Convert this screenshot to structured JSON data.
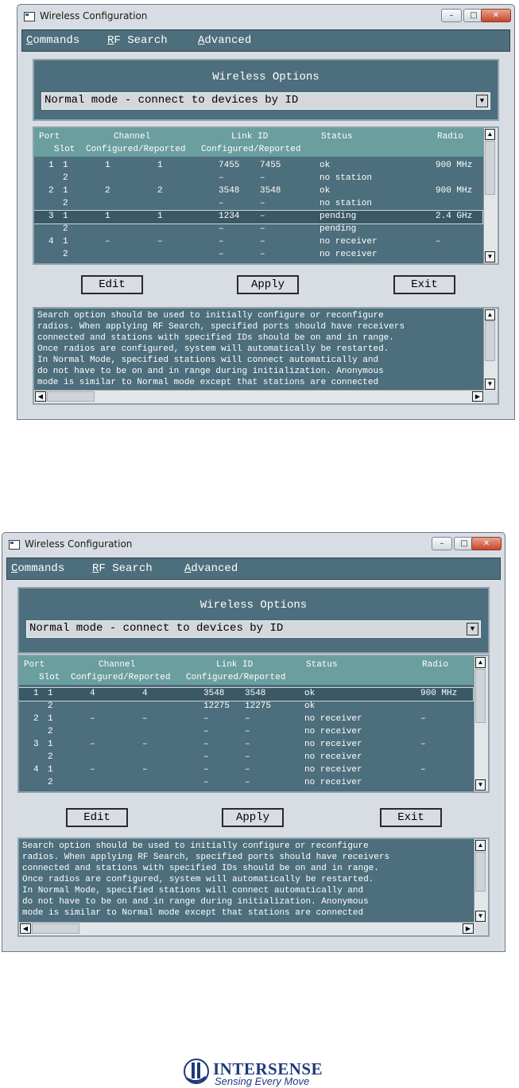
{
  "windows": [
    {
      "title": "Wireless Configuration",
      "controls": {
        "minimize": "–",
        "maximize": "□",
        "close": "✕"
      },
      "menu": [
        {
          "label_rest": "ommands",
          "accel": "C"
        },
        {
          "label_rest": "F Search",
          "accel": "R"
        },
        {
          "label_rest": "dvanced",
          "accel": "A"
        }
      ],
      "options_title": "Wireless Options",
      "mode": "Normal mode - connect to devices by ID",
      "headers": {
        "port": "Port",
        "slot": "Slot",
        "channel": "Channel",
        "channel_sub": "Configured/Reported",
        "link_id": "Link ID",
        "link_id_sub": "Configured/Reported",
        "status": "Status",
        "radio": "Radio"
      },
      "rows": [
        {
          "port": "1",
          "slot": "1",
          "ch_conf": "1",
          "ch_rep": "1",
          "id_conf": "7455",
          "id_rep": "7455",
          "status": "ok",
          "radio": "900 MHz"
        },
        {
          "port": "",
          "slot": "2",
          "ch_conf": "",
          "ch_rep": "",
          "id_conf": "–",
          "id_rep": "–",
          "status": "no station",
          "radio": ""
        },
        {
          "port": "2",
          "slot": "1",
          "ch_conf": "2",
          "ch_rep": "2",
          "id_conf": "3548",
          "id_rep": "3548",
          "status": "ok",
          "radio": "900 MHz"
        },
        {
          "port": "",
          "slot": "2",
          "ch_conf": "",
          "ch_rep": "",
          "id_conf": "–",
          "id_rep": "–",
          "status": "no station",
          "radio": ""
        },
        {
          "port": "3",
          "slot": "1",
          "ch_conf": "1",
          "ch_rep": "1",
          "id_conf": "1234",
          "id_rep": "–",
          "status": "pending",
          "radio": "2.4 GHz"
        },
        {
          "port": "",
          "slot": "2",
          "ch_conf": "",
          "ch_rep": "",
          "id_conf": "–",
          "id_rep": "–",
          "status": "pending",
          "radio": ""
        },
        {
          "port": "4",
          "slot": "1",
          "ch_conf": "–",
          "ch_rep": "–",
          "id_conf": "–",
          "id_rep": "–",
          "status": "no receiver",
          "radio": "–"
        },
        {
          "port": "",
          "slot": "2",
          "ch_conf": "",
          "ch_rep": "",
          "id_conf": "–",
          "id_rep": "–",
          "status": "no receiver",
          "radio": ""
        }
      ],
      "selected_row": 4,
      "buttons": {
        "edit": "Edit",
        "apply": "Apply",
        "exit": "Exit"
      },
      "help_lines": [
        "Search option should be used to initially configure or reconfigure",
        "radios. When applying RF Search, specified ports should have receivers",
        "connected and stations with specified IDs should be on and in range.",
        "Once radios are configured, system will automatically be restarted.",
        "In Normal Mode, specified stations will connect automatically and",
        "do not have to be on and in range during initialization. Anonymous",
        "mode is similar to Normal mode except that stations are connected"
      ]
    },
    {
      "title": "Wireless Configuration",
      "controls": {
        "minimize": "–",
        "maximize": "□",
        "close": "✕"
      },
      "menu": [
        {
          "label_rest": "ommands",
          "accel": "C"
        },
        {
          "label_rest": "F Search",
          "accel": "R"
        },
        {
          "label_rest": "dvanced",
          "accel": "A"
        }
      ],
      "options_title": "Wireless Options",
      "mode": "Normal mode - connect to devices by ID",
      "headers": {
        "port": "Port",
        "slot": "Slot",
        "channel": "Channel",
        "channel_sub": "Configured/Reported",
        "link_id": "Link ID",
        "link_id_sub": "Configured/Reported",
        "status": "Status",
        "radio": "Radio"
      },
      "rows": [
        {
          "port": "1",
          "slot": "1",
          "ch_conf": "4",
          "ch_rep": "4",
          "id_conf": "3548",
          "id_rep": "3548",
          "status": "ok",
          "radio": "900 MHz"
        },
        {
          "port": "",
          "slot": "2",
          "ch_conf": "",
          "ch_rep": "",
          "id_conf": "12275",
          "id_rep": "12275",
          "status": "ok",
          "radio": ""
        },
        {
          "port": "2",
          "slot": "1",
          "ch_conf": "–",
          "ch_rep": "–",
          "id_conf": "–",
          "id_rep": "–",
          "status": "no receiver",
          "radio": "–"
        },
        {
          "port": "",
          "slot": "2",
          "ch_conf": "",
          "ch_rep": "",
          "id_conf": "–",
          "id_rep": "–",
          "status": "no receiver",
          "radio": ""
        },
        {
          "port": "3",
          "slot": "1",
          "ch_conf": "–",
          "ch_rep": "–",
          "id_conf": "–",
          "id_rep": "–",
          "status": "no receiver",
          "radio": "–"
        },
        {
          "port": "",
          "slot": "2",
          "ch_conf": "",
          "ch_rep": "",
          "id_conf": "–",
          "id_rep": "–",
          "status": "no receiver",
          "radio": ""
        },
        {
          "port": "4",
          "slot": "1",
          "ch_conf": "–",
          "ch_rep": "–",
          "id_conf": "–",
          "id_rep": "–",
          "status": "no receiver",
          "radio": "–"
        },
        {
          "port": "",
          "slot": "2",
          "ch_conf": "",
          "ch_rep": "",
          "id_conf": "–",
          "id_rep": "–",
          "status": "no receiver",
          "radio": ""
        }
      ],
      "selected_row": 0,
      "buttons": {
        "edit": "Edit",
        "apply": "Apply",
        "exit": "Exit"
      },
      "help_lines": [
        "Search option should be used to initially configure or reconfigure",
        "radios. When applying RF Search, specified ports should have receivers",
        "connected and stations with specified IDs should be on and in range.",
        "Once radios are configured, system will automatically be restarted.",
        "In Normal Mode, specified stations will connect automatically and",
        "do not have to be on and in range during initialization. Anonymous",
        "mode is similar to Normal mode except that stations are connected"
      ]
    }
  ],
  "logo": {
    "brand": "INTERSENSE",
    "tagline": "Sensing Every Move",
    "color": "#1f3a7a"
  },
  "colors": {
    "panel": "#4d6e7c",
    "header": "#6b9e9e",
    "window_bg": "#d8dde3"
  }
}
